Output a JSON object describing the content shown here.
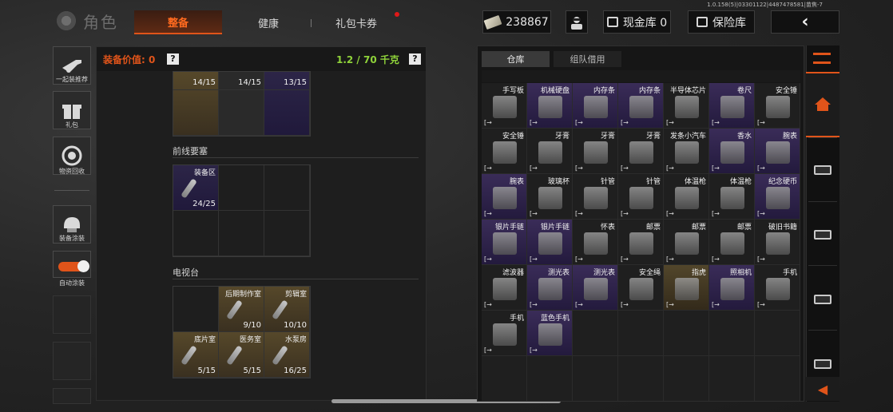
{
  "version": "1.0.158(5)|03301122|4487478581|苗焦-7",
  "header": {
    "title": "角色",
    "tabs": [
      {
        "label": "整备",
        "active": true
      },
      {
        "label": "健康",
        "active": false
      },
      {
        "label": "礼包卡券",
        "active": false,
        "badge": true
      }
    ],
    "money": "238867",
    "cash_store": "现金库 0",
    "vault": "保险库",
    "back": "‹"
  },
  "sidebar": [
    {
      "label": "一起装推荐",
      "icon": "rifle-icon"
    },
    {
      "label": "礼包",
      "icon": "gift-icon"
    },
    {
      "label": "物资回收",
      "icon": "recycle-icon"
    },
    {
      "label": "装备涂装",
      "icon": "helmet-icon"
    },
    {
      "label": "自动涂装",
      "icon": "toggle-icon"
    }
  ],
  "equip": {
    "value_label": "装备价值: 0",
    "weight_label": "1.2 / 70 千克",
    "help": "?",
    "top_row": [
      {
        "count": "14/15",
        "rarity": "gold"
      },
      {
        "count": "14/15",
        "rarity": "plain"
      },
      {
        "count": "13/15",
        "rarity": "purple"
      }
    ],
    "sections": [
      {
        "title": "前线要塞",
        "cells": [
          {
            "name": "装备区",
            "count": "24/25",
            "rarity": "purple"
          }
        ]
      },
      {
        "title": "电视台",
        "cells": [
          {
            "name": "",
            "count": "",
            "rarity": "plain"
          },
          {
            "name": "后期制作室",
            "count": "9/10",
            "rarity": "gold"
          },
          {
            "name": "剪辑室",
            "count": "10/10",
            "rarity": "gold"
          },
          {
            "name": "底片室",
            "count": "5/15",
            "rarity": "gold"
          },
          {
            "name": "医务室",
            "count": "5/15",
            "rarity": "gold"
          },
          {
            "name": "水泵房",
            "count": "16/25",
            "rarity": "gold"
          }
        ]
      }
    ]
  },
  "storage": {
    "tabs": [
      "仓库",
      "组队借用"
    ],
    "items": [
      {
        "name": "手写板",
        "rarity": "plain"
      },
      {
        "name": "机械硬盘",
        "rarity": "purple"
      },
      {
        "name": "内存条",
        "rarity": "purple"
      },
      {
        "name": "内存条",
        "rarity": "purple"
      },
      {
        "name": "半导体芯片",
        "rarity": "plain"
      },
      {
        "name": "卷尺",
        "rarity": "purple"
      },
      {
        "name": "安全锤",
        "rarity": "plain"
      },
      {
        "name": "安全锤",
        "rarity": "plain"
      },
      {
        "name": "牙膏",
        "rarity": "plain"
      },
      {
        "name": "牙膏",
        "rarity": "plain"
      },
      {
        "name": "牙膏",
        "rarity": "plain"
      },
      {
        "name": "发条小汽车",
        "rarity": "plain"
      },
      {
        "name": "香水",
        "rarity": "purple"
      },
      {
        "name": "腕表",
        "rarity": "purple"
      },
      {
        "name": "腕表",
        "rarity": "purple"
      },
      {
        "name": "玻璃杯",
        "rarity": "plain"
      },
      {
        "name": "针管",
        "rarity": "plain"
      },
      {
        "name": "针管",
        "rarity": "plain"
      },
      {
        "name": "体温枪",
        "rarity": "plain"
      },
      {
        "name": "体温枪",
        "rarity": "plain"
      },
      {
        "name": "纪念硬币",
        "rarity": "purple"
      },
      {
        "name": "银片手链",
        "rarity": "purple"
      },
      {
        "name": "银片手链",
        "rarity": "purple"
      },
      {
        "name": "怀表",
        "rarity": "plain"
      },
      {
        "name": "邮票",
        "rarity": "plain"
      },
      {
        "name": "邮票",
        "rarity": "plain"
      },
      {
        "name": "邮票",
        "rarity": "plain"
      },
      {
        "name": "破旧书籍",
        "rarity": "plain"
      },
      {
        "name": "滤波器",
        "rarity": "plain"
      },
      {
        "name": "测光表",
        "rarity": "purple"
      },
      {
        "name": "测光表",
        "rarity": "purple"
      },
      {
        "name": "安全绳",
        "rarity": "plain"
      },
      {
        "name": "指虎",
        "rarity": "gold"
      },
      {
        "name": "照相机",
        "rarity": "purple"
      },
      {
        "name": "手机",
        "rarity": "plain"
      },
      {
        "name": "手机",
        "rarity": "plain"
      },
      {
        "name": "蓝色手机",
        "rarity": "purple"
      }
    ],
    "empty_cells": 12,
    "export_glyph": "[→"
  },
  "colors": {
    "accent": "#e0541a",
    "weight_green": "#8fd33a",
    "purple_rarity": "#3a2c58",
    "gold_rarity": "#52462b"
  }
}
